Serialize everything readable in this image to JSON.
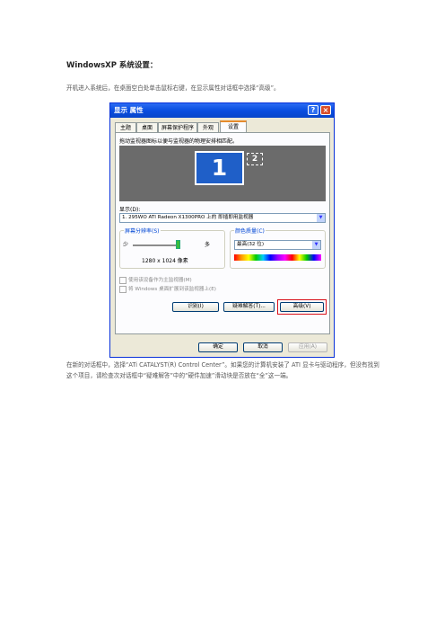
{
  "doc": {
    "title": "WindowsXP 系统设置：",
    "para1": "开机进入系统后，在桌面空白处单击鼠标右键，在显示属性对话框中选择“高级”。",
    "para2": "在新的对话框中，选择“ATi CATALYST(R) Control Center”。如果您的计算机安装了 ATI 显卡与驱动程序，但没有找到这个项目，请检查次对话框中“疑难解答”中的“硬件加速”滑动块是否放在“全”这一端。"
  },
  "dialog": {
    "title": "显示 属性",
    "help": "?",
    "close": "×",
    "tabs": [
      "主题",
      "桌面",
      "屏幕保护程序",
      "外观",
      "设置"
    ],
    "instruction": "拖动监视器图标以便与监视器的物理安排相匹配。",
    "monitor1": "1",
    "monitor2": "2",
    "display_label": "显示(D):",
    "display_value": "1. 295WO ATI Radeon X1300PRO 上的 即插即用监视器",
    "resolution_group": "屏幕分辨率(S)",
    "less": "少",
    "more": "多",
    "resolution_value": "1280 x 1024 像素",
    "color_group": "颜色质量(C)",
    "color_value": "最高(32 位)",
    "check1": "使用该设备作为主监视器(M)",
    "check2": "将 Windows 桌面扩展到该监视器上(E)",
    "btn_identify": "识别(I)",
    "btn_troubleshoot": "疑难解答(T)...",
    "btn_advanced": "高级(V)",
    "btn_ok": "确定",
    "btn_cancel": "取消",
    "btn_apply": "应用(A)"
  },
  "colors": {
    "highlight": "#d9111b",
    "xp_blue": "#0a4ee0"
  }
}
